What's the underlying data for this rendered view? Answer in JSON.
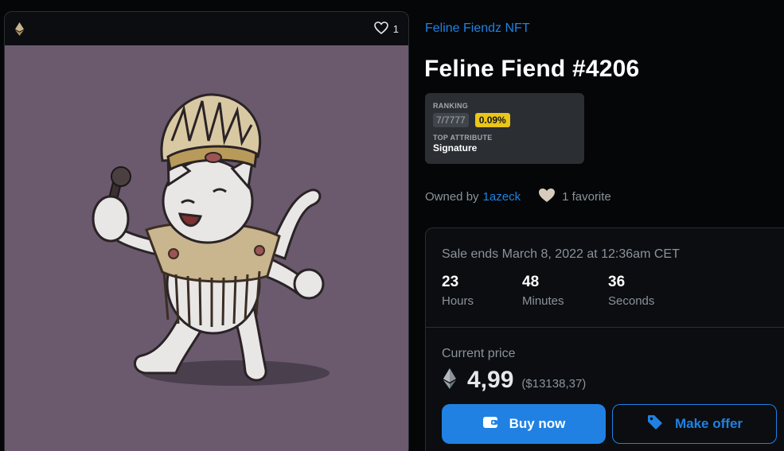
{
  "card": {
    "favorite_count": "1"
  },
  "collection": {
    "name": "Feline Fiendz NFT"
  },
  "item": {
    "title": "Feline Fiend #4206"
  },
  "ranking": {
    "label": "RANKING",
    "value": "7/7777",
    "percent": "0.09%",
    "top_attribute_label": "TOP ATTRIBUTE",
    "top_attribute_value": "Signature"
  },
  "owner": {
    "prefix": "Owned by",
    "name": "1azeck",
    "favorites": "1 favorite"
  },
  "sale": {
    "ends_text": "Sale ends March 8, 2022 at 12:36am CET",
    "countdown": [
      {
        "value": "23",
        "unit": "Hours"
      },
      {
        "value": "48",
        "unit": "Minutes"
      },
      {
        "value": "36",
        "unit": "Seconds"
      }
    ],
    "price_label": "Current price",
    "price": "4,99",
    "price_fiat": "($13138,37)",
    "buy_label": "Buy now",
    "offer_label": "Make offer"
  },
  "colors": {
    "accent": "#2081e2",
    "background": "#040608",
    "art_background": "#6b5a6e",
    "badge_yellow": "#e9c619"
  },
  "icons": {
    "currency": "ethereum-icon",
    "favorite": "heart-icon",
    "wallet": "wallet-icon",
    "tag": "tag-icon"
  }
}
